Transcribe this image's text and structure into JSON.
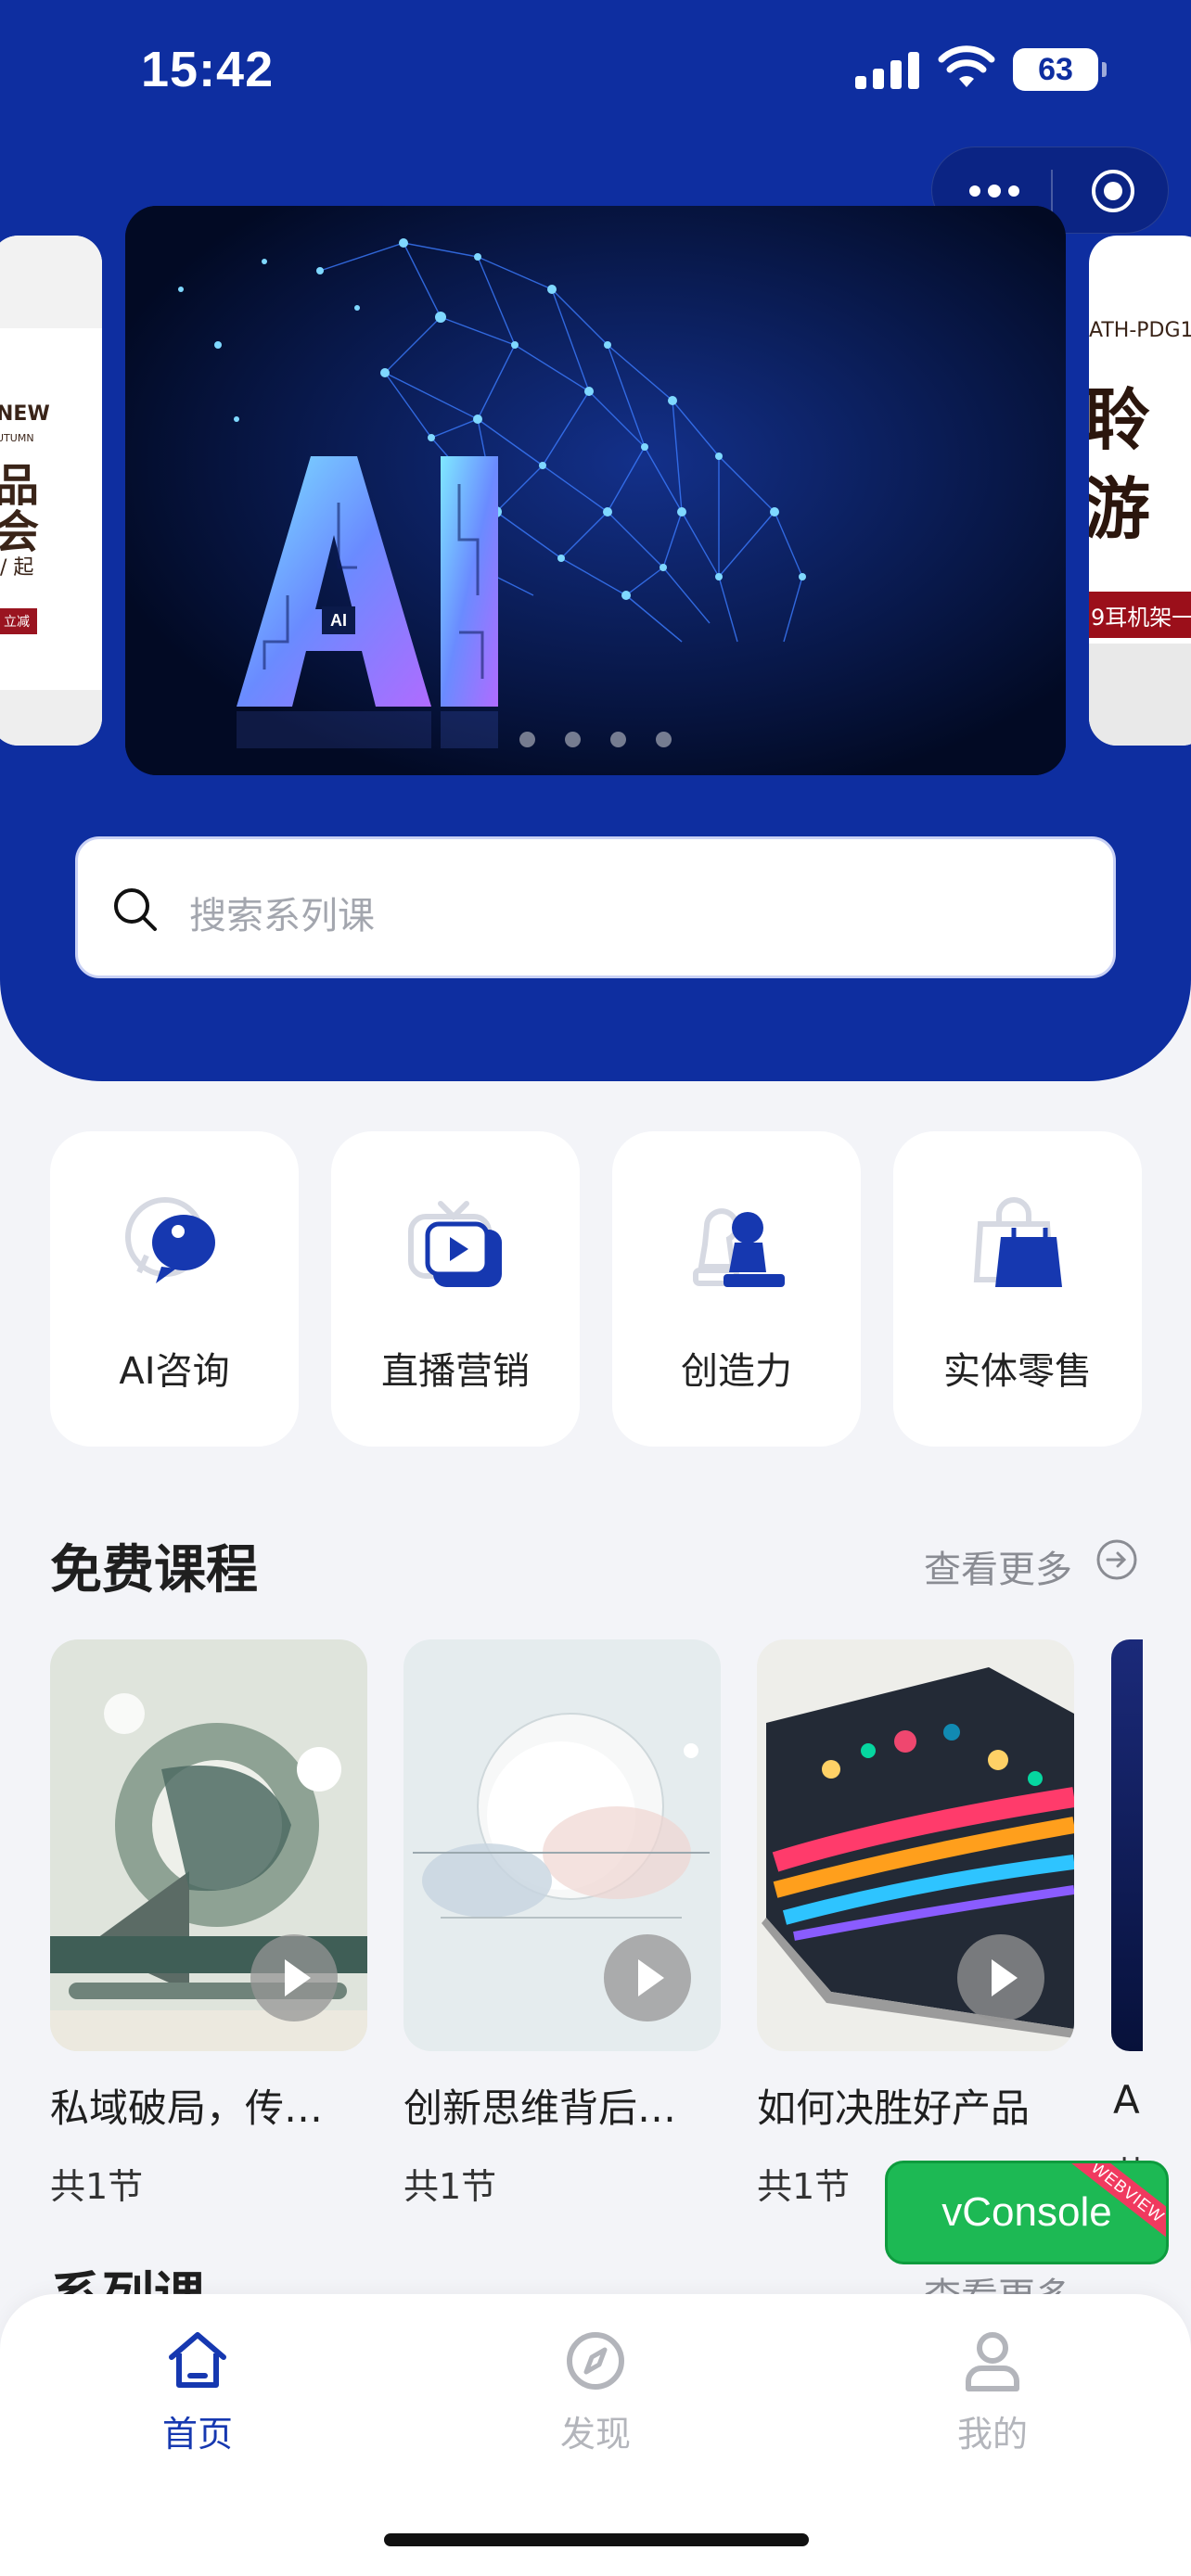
{
  "status_bar": {
    "time": "15:42",
    "battery": "63"
  },
  "banner": {
    "center_text": "AI",
    "badge": "AI",
    "page_count": 4,
    "left_card": {
      "line1": "NEW",
      "line2": "UTUMN",
      "line3": "品",
      "line4": "会",
      "line5": "/ 起",
      "tag": "立减"
    },
    "right_card": {
      "line1": "ATH-PDG1",
      "line2": "聆",
      "line3": "游",
      "line4": "9耳机架一"
    }
  },
  "search": {
    "placeholder": "搜索系列课"
  },
  "categories": [
    {
      "label": "AI咨询",
      "icon": "chat-bubble-icon"
    },
    {
      "label": "直播营销",
      "icon": "tv-play-icon"
    },
    {
      "label": "创造力",
      "icon": "chess-piece-icon"
    },
    {
      "label": "实体零售",
      "icon": "shopping-bag-icon"
    }
  ],
  "free_courses": {
    "title": "免费课程",
    "more": "查看更多",
    "items": [
      {
        "name": "私域破局，传…",
        "count": "共1节"
      },
      {
        "name": "创新思维背后…",
        "count": "共1节"
      },
      {
        "name": "如何决胜好产品",
        "count": "共1节"
      },
      {
        "name": "A",
        "count": "共"
      }
    ]
  },
  "series": {
    "title": "系列课",
    "more": "查看更多"
  },
  "vconsole": {
    "label": "vConsole",
    "ribbon": "WEBVIEW"
  },
  "tabbar": [
    {
      "label": "首页",
      "icon": "home-icon",
      "active": true
    },
    {
      "label": "发现",
      "icon": "compass-icon",
      "active": false
    },
    {
      "label": "我的",
      "icon": "user-icon",
      "active": false
    }
  ],
  "colors": {
    "brand_blue": "#0E2EA0",
    "tab_active": "#1638B0",
    "vconsole_green": "#1DB954"
  }
}
